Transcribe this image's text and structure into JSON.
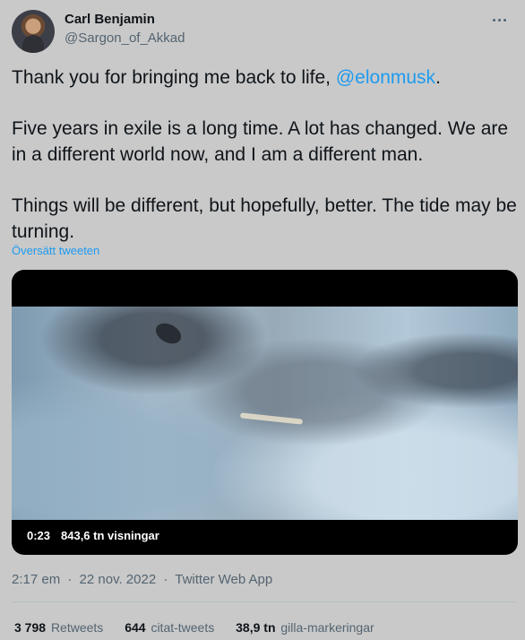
{
  "author": {
    "name": "Carl Benjamin",
    "handle": "@Sargon_of_Akkad"
  },
  "tweet": {
    "line1_before": "Thank you for bringing me back to life, ",
    "mention": "@elonmusk",
    "line1_after": ".",
    "paragraph2": "Five years in exile is a long time. A lot has changed. We are in a different world now, and I am a different man.",
    "paragraph3": "Things will be different, but hopefully, better. The tide may be turning.",
    "translate_label": "Översätt tweeten"
  },
  "video": {
    "duration": "0:23",
    "views": "843,6 tn visningar"
  },
  "meta": {
    "time": "2:17 em",
    "separator": "·",
    "date": "22 nov. 2022",
    "client": "Twitter Web App"
  },
  "stats": {
    "retweets_count": "3 798",
    "retweets_label": "Retweets",
    "quotes_count": "644",
    "quotes_label": "citat-tweets",
    "likes_count": "38,9 tn",
    "likes_label": "gilla-markeringar"
  },
  "colors": {
    "accent": "#1d9bf0",
    "text": "#0f1419",
    "secondary": "#536471",
    "background": "#c9c9c9"
  }
}
